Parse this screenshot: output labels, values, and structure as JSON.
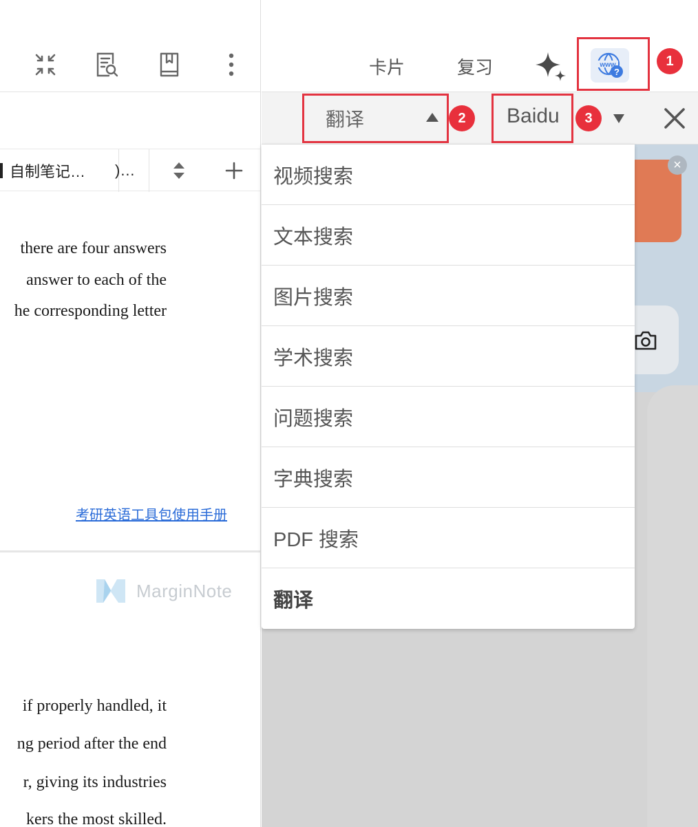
{
  "left_pane": {
    "toolbar_icons": [
      "collapse-icon",
      "document-search-icon",
      "bookmark-book-icon",
      "more-vertical-icon"
    ],
    "tabs": [
      {
        "label": "自制笔记…"
      },
      {
        "label": ")…"
      }
    ],
    "doc_lines_top": [
      "there are four answers",
      "answer to each of the",
      "he corresponding letter"
    ],
    "manual_link": "考研英语工具包使用手册",
    "watermark": "MarginNote",
    "doc_lines_bottom": [
      "if properly handled, it",
      "ng period after the end",
      "r, giving its industries",
      "kers the most skilled."
    ]
  },
  "right_pane": {
    "toolbar": {
      "card_label": "卡片",
      "review_label": "复习"
    },
    "search_bar": {
      "mode": "翻译",
      "engine": "Baidu"
    },
    "dropdown_items": [
      {
        "label": "视频搜索",
        "selected": false
      },
      {
        "label": "文本搜索",
        "selected": false
      },
      {
        "label": "图片搜索",
        "selected": false
      },
      {
        "label": "学术搜索",
        "selected": false
      },
      {
        "label": "问题搜索",
        "selected": false
      },
      {
        "label": "字典搜索",
        "selected": false
      },
      {
        "label": "PDF 搜索",
        "selected": false
      },
      {
        "label": "翻译",
        "selected": true
      }
    ]
  },
  "annotations": {
    "badges": [
      "1",
      "2",
      "3"
    ],
    "color": "#e33340"
  },
  "colors": {
    "accent_blue": "#2b6cd8",
    "web_icon_bg": "#e7eef8"
  }
}
